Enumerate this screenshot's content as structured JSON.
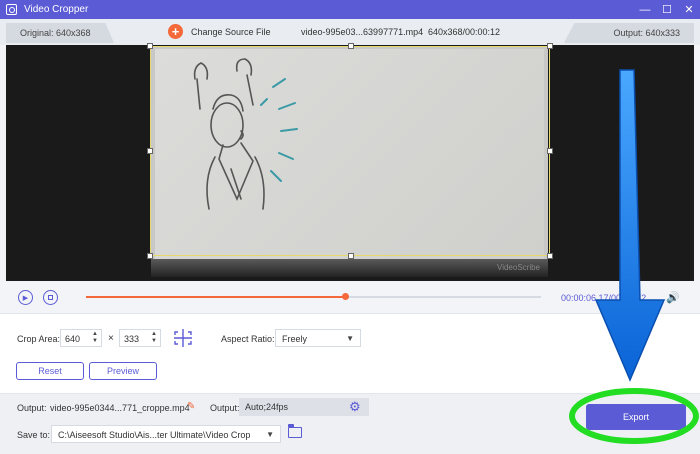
{
  "titlebar": {
    "title": "Video Cropper",
    "minimize": "—",
    "maximize": "☐",
    "close": "✕"
  },
  "infobar": {
    "original": "Original: 640x368",
    "change_source": "Change Source File",
    "file_name": "video-995e03...63997771.mp4",
    "file_meta": "640x368/00:00:12",
    "output": "Output: 640x333"
  },
  "preview": {
    "watermark": "VideoScribe"
  },
  "playback": {
    "time": "00:00:06.17/00:00:12",
    "progress": 0.57
  },
  "crop": {
    "crop_area_label": "Crop Area:",
    "width": "640",
    "height": "333",
    "times": "×",
    "aspect_label": "Aspect Ratio:",
    "aspect_value": "Freely",
    "reset_label": "Reset",
    "preview_label": "Preview"
  },
  "footer": {
    "output_label": "Output:",
    "output_file": "video-995e0344...771_croppe.mp4",
    "output2_label": "Output:",
    "output_format": "Auto;24fps",
    "save_to_label": "Save to:",
    "save_path": "C:\\Aiseesoft Studio\\Ais...ter Ultimate\\Video Crop",
    "export_label": "Export"
  },
  "colors": {
    "accent": "#5b5bd6",
    "orange": "#f4683a",
    "annotation_blue": "#1e7ff0",
    "annotation_green": "#22dd22"
  },
  "icons": [
    "app-icon",
    "plus-icon",
    "play-icon",
    "stop-icon",
    "volume-icon",
    "center-crop-icon",
    "edit-icon",
    "gear-icon",
    "folder-icon"
  ]
}
